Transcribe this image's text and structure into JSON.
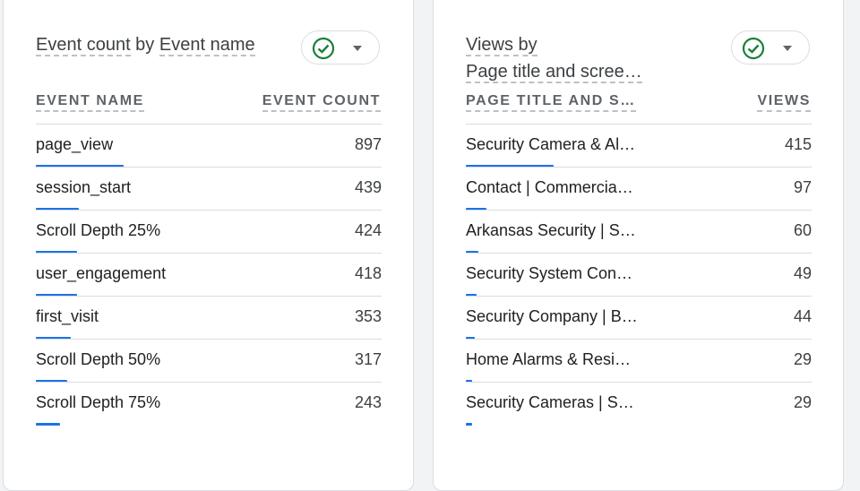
{
  "left_card": {
    "title_part1": "Event count",
    "title_by": " by ",
    "title_part2": "Event name",
    "col_dimension": "EVENT NAME",
    "col_metric": "EVENT COUNT",
    "max_value": 897,
    "rows": [
      {
        "label": "page_view",
        "value": "897",
        "share": 1.0
      },
      {
        "label": "session_start",
        "value": "439",
        "share": 0.489
      },
      {
        "label": "Scroll Depth 25%",
        "value": "424",
        "share": 0.473
      },
      {
        "label": "user_engagement",
        "value": "418",
        "share": 0.466
      },
      {
        "label": "first_visit",
        "value": "353",
        "share": 0.394
      },
      {
        "label": "Scroll Depth 50%",
        "value": "317",
        "share": 0.353
      },
      {
        "label": "Scroll Depth 75%",
        "value": "243",
        "share": 0.271
      }
    ]
  },
  "right_card": {
    "title_part1": "Views by",
    "title_part2": "Page title and scree…",
    "col_dimension": "PAGE TITLE AND S…",
    "col_metric": "VIEWS",
    "rows": [
      {
        "label": "Security Camera & Al…",
        "value": "415",
        "share": 1.0
      },
      {
        "label": "Contact | Commercia…",
        "value": "97",
        "share": 0.234
      },
      {
        "label": "Arkansas Security | S…",
        "value": "60",
        "share": 0.145
      },
      {
        "label": "Security System Con…",
        "value": "49",
        "share": 0.118
      },
      {
        "label": "Security Company | B…",
        "value": "44",
        "share": 0.106
      },
      {
        "label": "Home Alarms & Resi…",
        "value": "29",
        "share": 0.07
      },
      {
        "label": "Security Cameras | S…",
        "value": "29",
        "share": 0.07
      }
    ]
  },
  "icons": {
    "status": "check-circle-icon",
    "dropdown": "caret-down-icon",
    "search": "search-icon"
  },
  "colors": {
    "accent_bar": "#1a73e8",
    "status_green": "#188038"
  }
}
